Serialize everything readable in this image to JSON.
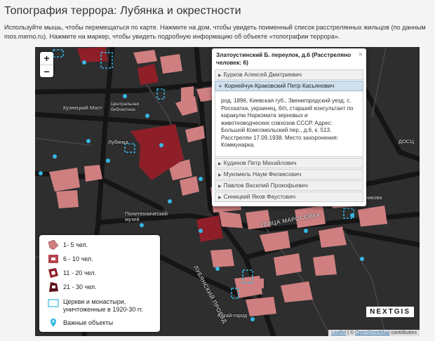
{
  "page": {
    "title": "Топография террора: Лубянка и окрестности",
    "intro": "Используйте мышь, чтобы перемещаться по карте. Нажмите на дом, чтобы увидеть поименный список расстрелянных жильцов (по данным mos.memo.ru). Нажмите на маркер, чтобы увидеть подробную информацию об объекте «топографии террора»."
  },
  "map": {
    "zoom_in": "+",
    "zoom_out": "−",
    "labels": {
      "kuznetsky": "Кузнецкий Мост",
      "lubyanka": "Лубянка",
      "museum": "Политехнический музей",
      "kitai": "Китай-город",
      "library": "Центральная библиотека",
      "nearby": "Дом Хлебникова",
      "doc": "ДОСЦ",
      "street_maroseyka": "УЛИЦА МАРОСЕЙКА",
      "street_lubyansky": "ЛУБЯНСКИЙ ПРОЕЗД"
    },
    "colors": {
      "background": "#2e2e2e",
      "building_light": "#cf7f80",
      "building_dark": "#8e1f28",
      "church": "#36b8e6",
      "marker": "#36b8e6"
    }
  },
  "popup": {
    "title": "Златоустинский Б. переулок, д.6 (Расстреляно человек: 6)",
    "close": "×",
    "persons": [
      {
        "name": "Бурков Алексей Дмитриевич",
        "expanded": false
      },
      {
        "name": "Корнейчук-Краковский Петр Касьянович",
        "expanded": true,
        "details": "род. 1896, Киевская губ., Звенигородский уезд, с. Росохатка, украинец, б/п, старший консультант по каракулю Наркомата зерновых и животноводческих совхозов СССР. Адрес: Большой Комсомольский пер., д.6, к. 513. Расстрелян 17.09.1938. Место захоронения: Коммунарка."
      },
      {
        "name": "Кудинов Петр Михайлович",
        "expanded": false
      },
      {
        "name": "Мукомель Наум Феликсович",
        "expanded": false
      },
      {
        "name": "Павлов Василий Прокофьевич",
        "expanded": false
      },
      {
        "name": "Синицкий Яков Фаустович",
        "expanded": false
      }
    ]
  },
  "legend": {
    "items": [
      {
        "label": "1- 5 чел."
      },
      {
        "label": "6 - 10 чел."
      },
      {
        "label": "11 - 20 чел."
      },
      {
        "label": "21 - 30 чел."
      },
      {
        "label": "Церкви и монастыри, уничтоженные в 1920-30 гг."
      },
      {
        "label": "Важные объекты"
      }
    ]
  },
  "brand": "NEXTGIS",
  "attribution": {
    "leaflet": "Leaflet",
    "sep": " | © ",
    "osm": "OpenStreetMap",
    "contributors": " contributors"
  }
}
